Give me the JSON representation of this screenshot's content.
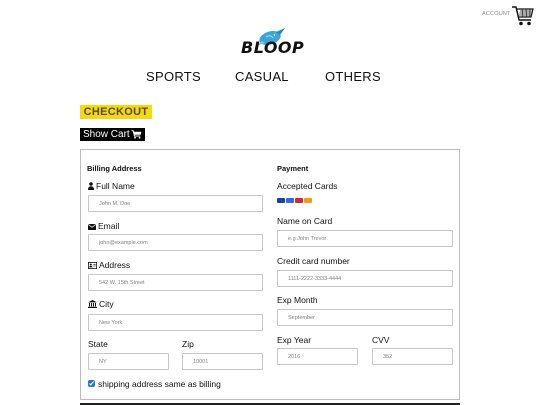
{
  "header": {
    "account_label": "ACCOUNT",
    "logo_text": "BLOOP"
  },
  "nav": {
    "items": [
      {
        "label": "SPORTS"
      },
      {
        "label": "CASUAL"
      },
      {
        "label": "OTHERS"
      }
    ]
  },
  "page": {
    "checkout_label": "CHECKOUT",
    "show_cart_label": "Show Cart"
  },
  "billing": {
    "title": "Billing Address",
    "full_name": {
      "label": "Full Name",
      "placeholder": "John M. Doe"
    },
    "email": {
      "label": "Email",
      "placeholder": "john@example.com"
    },
    "address": {
      "label": "Address",
      "placeholder": "542 W. 15th Street"
    },
    "city": {
      "label": "City",
      "placeholder": "New York"
    },
    "state": {
      "label": "State",
      "placeholder": "NY"
    },
    "zip": {
      "label": "Zip",
      "placeholder": "10001"
    },
    "same_as_billing": {
      "label": "shipping address same as billing",
      "checked": true
    }
  },
  "payment": {
    "title": "Payment",
    "accepted_cards_label": "Accepted Cards",
    "card_icons": [
      "visa-card-icon",
      "amex-card-icon",
      "mastercard-card-icon",
      "discover-card-icon"
    ],
    "name_on_card": {
      "label": "Name on Card",
      "placeholder": "e.g John Trevor"
    },
    "card_number": {
      "label": "Credit card number",
      "placeholder": "1111-2222-3333-4444"
    },
    "exp_month": {
      "label": "Exp Month",
      "placeholder": "September"
    },
    "exp_year": {
      "label": "Exp Year",
      "placeholder": "2016"
    },
    "cvv": {
      "label": "CVV",
      "placeholder": "352"
    }
  },
  "colors": {
    "checkout_bg": "#f5d80f",
    "checkout_text": "#5a4a2b",
    "show_cart_bg": "#000000",
    "checkbox_accent": "#1a73e8",
    "logo_bird": "#3aa7d8"
  }
}
